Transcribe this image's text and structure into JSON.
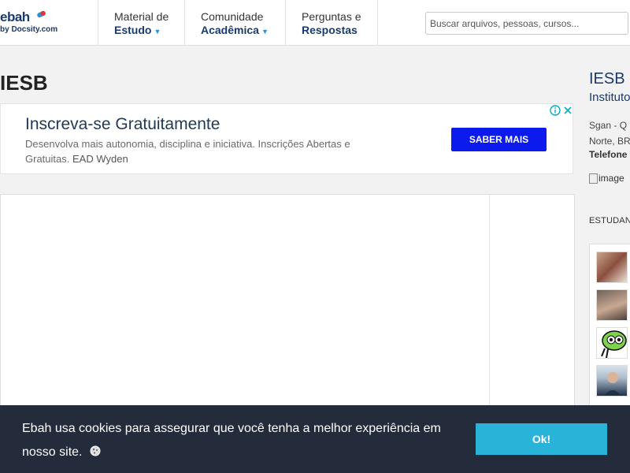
{
  "header": {
    "logo": {
      "main": "ebah",
      "sub": "by Docsity.com"
    },
    "nav": [
      {
        "line1": "Material de",
        "line2": "Estudo",
        "has_dropdown": true
      },
      {
        "line1": "Comunidade",
        "line2": "Acadêmica",
        "has_dropdown": true
      },
      {
        "line1": "Perguntas e",
        "line2": "Respostas",
        "has_dropdown": false
      }
    ],
    "search_placeholder": "Buscar arquivos, pessoas, cursos..."
  },
  "page": {
    "title": "IESB"
  },
  "ad": {
    "title": "Inscreva-se Gratuitamente",
    "description": "Desenvolva mais autonomia, disciplina e iniciativa. Inscrições Abertas e Gratuitas.",
    "brand": "EAD Wyden",
    "cta": "SABER MAIS",
    "cta_color": "#0b1bee"
  },
  "sidebar": {
    "title": "IESB",
    "subtitle": "Instituto",
    "address_line1": "Sgan - Q",
    "address_line2": "Norte, BR",
    "phone_label": "Telefone",
    "image_alt": "image",
    "section_title": "ESTUDAN"
  },
  "cookie": {
    "text": "Ebah usa cookies para assegurar que você tenha a melhor experiência em nosso site.",
    "button": "Ok!",
    "bar_color": "#242b3a",
    "button_color": "#2ab3d8"
  }
}
